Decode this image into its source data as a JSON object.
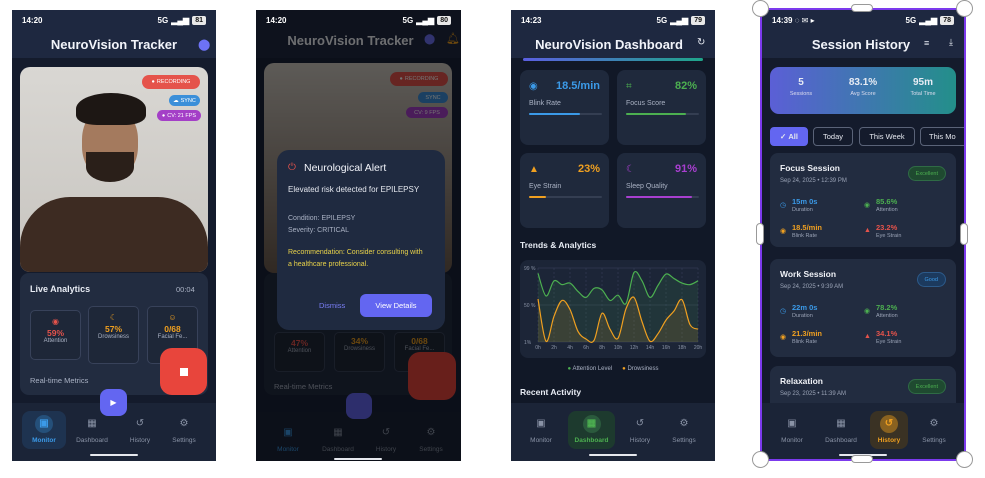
{
  "monitor": {
    "status": {
      "time": "14:20",
      "network": "5G",
      "battery": "81"
    },
    "title": "NeuroVision Tracker",
    "badges": {
      "recording": "RECORDING",
      "sync": "SYNC",
      "cv": "CV: 21 FPS"
    },
    "analytics": {
      "title": "Live Analytics",
      "timer": "00:04",
      "metrics": [
        {
          "value": "59%",
          "label": "Attention",
          "color": "#e5534b"
        },
        {
          "value": "57%",
          "label": "Drowsiness",
          "color": "#f0a020"
        },
        {
          "value": "0/68",
          "label": "Facial Fe...",
          "color": "#f0a020"
        }
      ],
      "footer": "Real-time Metrics"
    },
    "nav": [
      "Monitor",
      "Dashboard",
      "History",
      "Settings"
    ],
    "active_nav": "Monitor"
  },
  "alert_screen": {
    "status": {
      "time": "14:20",
      "network": "5G",
      "battery": "80"
    },
    "title": "NeuroVision Tracker",
    "badges": {
      "recording": "RECORDING",
      "sync": "SYNC",
      "cv": "CV: 9 FPS"
    },
    "metrics": [
      {
        "value": "47%",
        "label": "Attention"
      },
      {
        "value": "34%",
        "label": "Drowsiness"
      },
      {
        "value": "0/68",
        "label": "Facial Fe..."
      }
    ],
    "footer": "Real-time Metrics",
    "nav": [
      "Monitor",
      "Dashboard",
      "History",
      "Settings"
    ],
    "modal": {
      "title": "Neurological Alert",
      "message": "Elevated risk detected for EPILEPSY",
      "condition": "Condition: EPILEPSY",
      "severity": "Severity: CRITICAL",
      "recommendation": "Recommendation: Consider consulting with a healthcare professional.",
      "dismiss": "Dismiss",
      "view_details": "View Details"
    }
  },
  "dashboard": {
    "status": {
      "time": "14:23",
      "network": "5G",
      "battery": "79"
    },
    "title": "NeuroVision Dashboard",
    "cards": [
      {
        "value": "18.5/min",
        "label": "Blink Rate",
        "color": "#3b9ae8",
        "progress": 0.7,
        "icon": "eye-icon"
      },
      {
        "value": "82%",
        "label": "Focus Score",
        "color": "#4caf50",
        "progress": 0.82,
        "icon": "focus-icon"
      },
      {
        "value": "23%",
        "label": "Eye Strain",
        "color": "#f0a020",
        "progress": 0.23,
        "icon": "warning-icon"
      },
      {
        "value": "91%",
        "label": "Sleep Quality",
        "color": "#a83fd0",
        "progress": 0.91,
        "icon": "moon-icon"
      }
    ],
    "trends_title": "Trends & Analytics",
    "recent_title": "Recent Activity",
    "nav": [
      "Monitor",
      "Dashboard",
      "History",
      "Settings"
    ],
    "active_nav": "Dashboard"
  },
  "chart_data": {
    "type": "area",
    "x": [
      "0h",
      "1h",
      "2h",
      "3h",
      "4h",
      "5h",
      "6h",
      "7h",
      "8h",
      "9h",
      "10h",
      "11h",
      "12h",
      "13h",
      "14h",
      "15h",
      "16h",
      "17h",
      "18h",
      "19h",
      "20h"
    ],
    "x_tick_labels": [
      "0h",
      "2h",
      "4h",
      "6h",
      "8h",
      "10h",
      "12h",
      "14h",
      "16h",
      "18h",
      "20h"
    ],
    "y_tick_labels": [
      "99 %",
      "50 %",
      "1%"
    ],
    "ylim": [
      1,
      99
    ],
    "grid": true,
    "legend_position": "bottom",
    "series": [
      {
        "name": "Attention Level",
        "color": "#4caf50",
        "values": [
          92,
          62,
          82,
          77,
          79,
          68,
          60,
          72,
          70,
          56,
          63,
          52,
          93,
          82,
          60,
          76,
          91,
          85,
          79,
          77,
          82
        ]
      },
      {
        "name": "Drowsiness",
        "color": "#f0a020",
        "values": [
          58,
          2,
          35,
          56,
          44,
          15,
          5,
          3,
          39,
          18,
          6,
          45,
          60,
          28,
          2,
          12,
          30,
          42,
          57,
          24,
          18
        ]
      }
    ]
  },
  "history": {
    "status": {
      "time": "14:39",
      "network": "5G",
      "battery": "78"
    },
    "title": "Session History",
    "summary": [
      {
        "value": "5",
        "label": "Sessions"
      },
      {
        "value": "83.1%",
        "label": "Avg Score"
      },
      {
        "value": "95m",
        "label": "Total Time"
      }
    ],
    "filters": [
      "All",
      "Today",
      "This Week",
      "This Mo"
    ],
    "active_filter": "All",
    "sessions": [
      {
        "name": "Focus Session",
        "date": "Sep 24, 2025 • 12:39 PM",
        "rating": "Excellent",
        "duration": "15m 0s",
        "attention": "85.6%",
        "blink_rate": "18.5/min",
        "eye_strain": "23.2%"
      },
      {
        "name": "Work Session",
        "date": "Sep 24, 2025 • 9:39 AM",
        "rating": "Good",
        "duration": "22m 0s",
        "attention": "78.2%",
        "blink_rate": "21.3/min",
        "eye_strain": "34.1%"
      },
      {
        "name": "Relaxation",
        "date": "Sep 23, 2025 • 11:39 AM",
        "rating": "Excellent"
      }
    ],
    "stat_labels": {
      "duration": "Duration",
      "attention": "Attention",
      "blink_rate": "Blink Rate",
      "eye_strain": "Eye Strain"
    },
    "nav": [
      "Monitor",
      "Dashboard",
      "History",
      "Settings"
    ],
    "active_nav": "History"
  }
}
